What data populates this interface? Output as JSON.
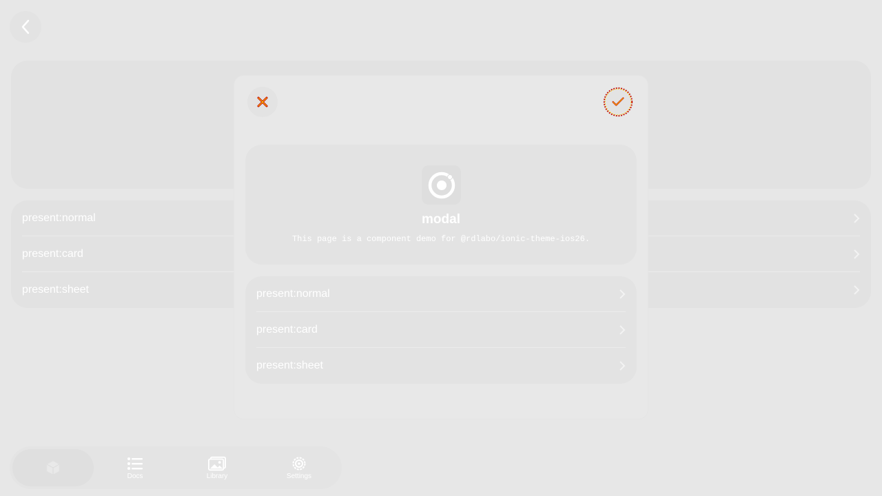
{
  "icons": {
    "back": "chevron-left-icon",
    "close": "xmark-icon",
    "confirm": "checkmark-icon",
    "logo": "ionic-logo-icon",
    "chevron": "chevron-right-icon"
  },
  "background_page": {
    "list": [
      {
        "label": "present:normal"
      },
      {
        "label": "present:card"
      },
      {
        "label": "present:sheet"
      }
    ]
  },
  "modal": {
    "title": "modal",
    "description": "This page is a component demo for @rdlabo/ionic-theme-ios26.",
    "list": [
      {
        "label": "present:normal"
      },
      {
        "label": "present:card"
      },
      {
        "label": "present:sheet"
      }
    ]
  },
  "tabbar": {
    "tabs": [
      {
        "label": "",
        "icon": "cube-icon",
        "active": true
      },
      {
        "label": "Docs",
        "icon": "list-icon"
      },
      {
        "label": "Library",
        "icon": "images-icon"
      },
      {
        "label": "Settings",
        "icon": "gear-icon"
      }
    ]
  },
  "colors": {
    "background": "#e7e7e7",
    "card": "#e2e2e2",
    "text": "#ffffff",
    "close_accent": "#c40000",
    "confirm_accent": "#c40000",
    "confirm_highlight": "#ffd400"
  }
}
